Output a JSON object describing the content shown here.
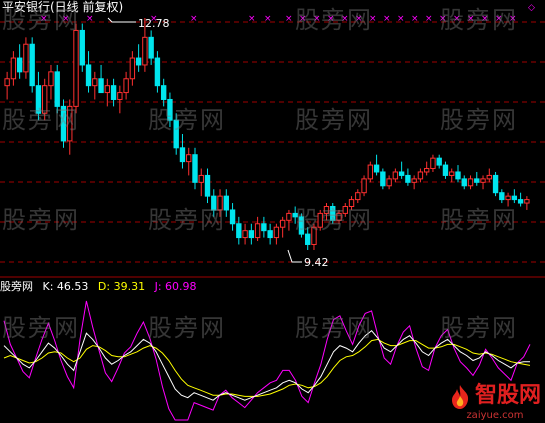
{
  "title": "平安银行(日线 前复权)",
  "annotations": {
    "high": "12.78",
    "low": "9.42"
  },
  "indicator": {
    "name": "股旁网",
    "k_text": "K: 46.53",
    "d_text": "D: 39.31",
    "j_text": "J: 60.98"
  },
  "watermark": "股旁网",
  "logo": {
    "text": "智股网",
    "url": "zaiyue.com"
  },
  "colors": {
    "background": "#000000",
    "up": "#ff3030",
    "down": "#00e5ee",
    "grid": "#a00000",
    "k_line": "#ffffff",
    "d_line": "#ffff00",
    "j_line": "#ff00ff",
    "marker": "#ff00ff"
  },
  "chart_data": {
    "type": "candlestick",
    "price_high": 12.78,
    "price_low": 9.42,
    "candles": [
      [
        11.8,
        12.0,
        11.6,
        11.9
      ],
      [
        11.9,
        12.3,
        11.8,
        12.2
      ],
      [
        12.2,
        12.4,
        11.9,
        12.0
      ],
      [
        12.0,
        12.5,
        11.9,
        12.4
      ],
      [
        12.4,
        12.5,
        11.7,
        11.8
      ],
      [
        11.8,
        12.0,
        11.3,
        11.4
      ],
      [
        11.4,
        11.9,
        11.3,
        11.8
      ],
      [
        11.8,
        12.1,
        11.6,
        12.0
      ],
      [
        12.0,
        12.1,
        11.4,
        11.5
      ],
      [
        11.5,
        11.6,
        10.9,
        11.0
      ],
      [
        11.0,
        11.6,
        10.8,
        11.5
      ],
      [
        11.5,
        12.7,
        11.4,
        12.6
      ],
      [
        12.6,
        12.7,
        12.0,
        12.1
      ],
      [
        12.1,
        12.3,
        11.7,
        11.8
      ],
      [
        11.8,
        12.0,
        11.6,
        11.9
      ],
      [
        11.9,
        12.1,
        11.7,
        11.7
      ],
      [
        11.7,
        11.9,
        11.5,
        11.8
      ],
      [
        11.8,
        11.9,
        11.5,
        11.6
      ],
      [
        11.6,
        11.8,
        11.4,
        11.7
      ],
      [
        11.7,
        12.0,
        11.6,
        11.9
      ],
      [
        11.9,
        12.3,
        11.8,
        12.2
      ],
      [
        12.2,
        12.4,
        12.0,
        12.1
      ],
      [
        12.1,
        12.78,
        12.0,
        12.5
      ],
      [
        12.5,
        12.6,
        12.1,
        12.2
      ],
      [
        12.2,
        12.3,
        11.7,
        11.8
      ],
      [
        11.8,
        11.9,
        11.5,
        11.6
      ],
      [
        11.6,
        11.7,
        11.2,
        11.3
      ],
      [
        11.3,
        11.4,
        10.8,
        10.9
      ],
      [
        10.9,
        11.1,
        10.6,
        10.7
      ],
      [
        10.7,
        10.9,
        10.5,
        10.8
      ],
      [
        10.8,
        10.9,
        10.3,
        10.4
      ],
      [
        10.4,
        10.6,
        10.2,
        10.5
      ],
      [
        10.5,
        10.6,
        10.1,
        10.2
      ],
      [
        10.2,
        10.3,
        9.9,
        10.0
      ],
      [
        10.0,
        10.3,
        9.9,
        10.2
      ],
      [
        10.2,
        10.3,
        9.9,
        10.0
      ],
      [
        10.0,
        10.1,
        9.7,
        9.8
      ],
      [
        9.8,
        9.9,
        9.5,
        9.6
      ],
      [
        9.6,
        9.8,
        9.5,
        9.7
      ],
      [
        9.7,
        9.8,
        9.5,
        9.6
      ],
      [
        9.6,
        9.9,
        9.55,
        9.8
      ],
      [
        9.8,
        9.9,
        9.6,
        9.7
      ],
      [
        9.7,
        9.8,
        9.5,
        9.6
      ],
      [
        9.6,
        9.8,
        9.5,
        9.75
      ],
      [
        9.75,
        9.9,
        9.6,
        9.85
      ],
      [
        9.85,
        10.0,
        9.7,
        9.95
      ],
      [
        9.95,
        10.05,
        9.8,
        9.9
      ],
      [
        9.9,
        9.95,
        9.6,
        9.65
      ],
      [
        9.65,
        9.75,
        9.42,
        9.5
      ],
      [
        9.5,
        9.8,
        9.42,
        9.75
      ],
      [
        9.75,
        10.0,
        9.7,
        9.95
      ],
      [
        9.95,
        10.1,
        9.85,
        10.05
      ],
      [
        10.05,
        10.1,
        9.8,
        9.85
      ],
      [
        9.85,
        10.0,
        9.8,
        9.95
      ],
      [
        9.95,
        10.1,
        9.9,
        10.05
      ],
      [
        10.05,
        10.2,
        10.0,
        10.15
      ],
      [
        10.15,
        10.3,
        10.1,
        10.25
      ],
      [
        10.25,
        10.5,
        10.2,
        10.45
      ],
      [
        10.45,
        10.7,
        10.4,
        10.65
      ],
      [
        10.65,
        10.8,
        10.5,
        10.55
      ],
      [
        10.55,
        10.6,
        10.3,
        10.35
      ],
      [
        10.35,
        10.5,
        10.3,
        10.45
      ],
      [
        10.45,
        10.6,
        10.4,
        10.55
      ],
      [
        10.55,
        10.7,
        10.45,
        10.5
      ],
      [
        10.5,
        10.6,
        10.35,
        10.4
      ],
      [
        10.4,
        10.5,
        10.3,
        10.45
      ],
      [
        10.45,
        10.6,
        10.4,
        10.55
      ],
      [
        10.55,
        10.7,
        10.5,
        10.6
      ],
      [
        10.6,
        10.8,
        10.55,
        10.75
      ],
      [
        10.75,
        10.8,
        10.6,
        10.65
      ],
      [
        10.65,
        10.7,
        10.45,
        10.5
      ],
      [
        10.5,
        10.6,
        10.4,
        10.55
      ],
      [
        10.55,
        10.65,
        10.4,
        10.45
      ],
      [
        10.45,
        10.5,
        10.3,
        10.35
      ],
      [
        10.35,
        10.5,
        10.3,
        10.45
      ],
      [
        10.45,
        10.55,
        10.35,
        10.4
      ],
      [
        10.4,
        10.5,
        10.3,
        10.45
      ],
      [
        10.45,
        10.6,
        10.4,
        10.5
      ],
      [
        10.5,
        10.55,
        10.2,
        10.25
      ],
      [
        10.25,
        10.3,
        10.1,
        10.15
      ],
      [
        10.15,
        10.25,
        10.05,
        10.2
      ],
      [
        10.2,
        10.3,
        10.1,
        10.15
      ],
      [
        10.15,
        10.25,
        10.05,
        10.1
      ],
      [
        10.1,
        10.2,
        10.0,
        10.15
      ]
    ],
    "k": [
      60,
      55,
      50,
      45,
      42,
      48,
      55,
      62,
      58,
      52,
      45,
      40,
      55,
      70,
      65,
      58,
      50,
      45,
      48,
      52,
      55,
      60,
      65,
      62,
      55,
      45,
      35,
      25,
      20,
      18,
      22,
      20,
      18,
      16,
      20,
      22,
      20,
      18,
      16,
      18,
      20,
      22,
      24,
      26,
      30,
      32,
      30,
      25,
      22,
      28,
      35,
      45,
      55,
      60,
      58,
      55,
      62,
      68,
      72,
      66,
      58,
      55,
      60,
      65,
      68,
      62,
      55,
      52,
      58,
      62,
      65,
      60,
      55,
      52,
      48,
      50,
      55,
      52,
      48,
      45,
      42,
      46,
      47,
      47
    ],
    "d": [
      50,
      52,
      50,
      48,
      46,
      47,
      50,
      54,
      55,
      54,
      50,
      47,
      50,
      57,
      60,
      59,
      56,
      52,
      51,
      51,
      53,
      55,
      58,
      60,
      58,
      54,
      48,
      40,
      33,
      28,
      26,
      24,
      22,
      20,
      20,
      21,
      21,
      20,
      19,
      19,
      19,
      20,
      21,
      23,
      25,
      28,
      29,
      28,
      26,
      27,
      30,
      35,
      42,
      48,
      51,
      52,
      55,
      59,
      64,
      65,
      62,
      60,
      60,
      62,
      64,
      64,
      61,
      58,
      58,
      59,
      61,
      61,
      59,
      57,
      54,
      53,
      54,
      53,
      51,
      49,
      47,
      46,
      45,
      44
    ],
    "j": [
      80,
      61,
      50,
      39,
      34,
      50,
      65,
      78,
      64,
      48,
      35,
      26,
      65,
      96,
      75,
      56,
      38,
      31,
      42,
      54,
      59,
      70,
      79,
      66,
      49,
      27,
      9,
      0,
      0,
      0,
      14,
      12,
      10,
      8,
      20,
      24,
      18,
      14,
      10,
      16,
      22,
      26,
      30,
      32,
      40,
      40,
      32,
      19,
      14,
      30,
      45,
      65,
      81,
      84,
      72,
      61,
      76,
      86,
      88,
      68,
      50,
      45,
      60,
      71,
      76,
      58,
      43,
      40,
      58,
      68,
      73,
      58,
      47,
      42,
      36,
      44,
      57,
      50,
      42,
      37,
      32,
      46,
      51,
      61
    ]
  }
}
